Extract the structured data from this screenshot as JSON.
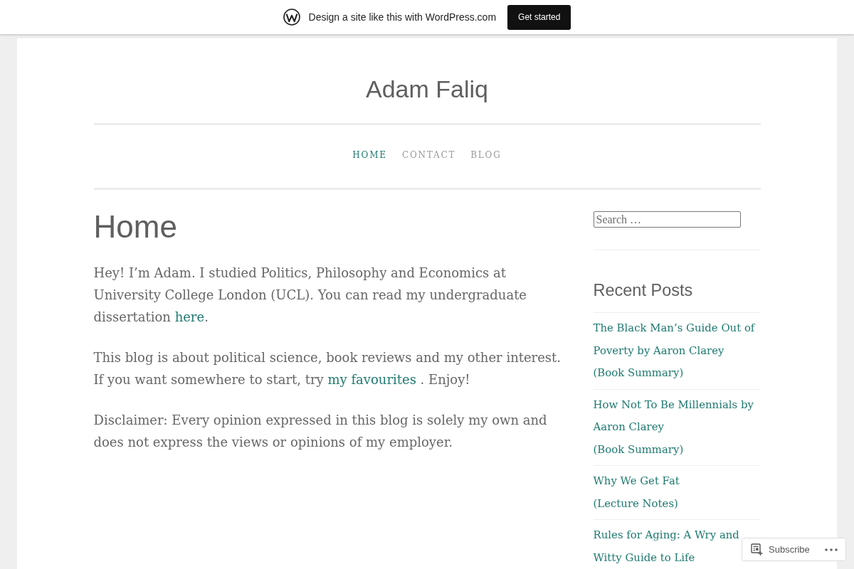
{
  "promo_bar": {
    "text": "Design a site like this with WordPress.com",
    "button": "Get started"
  },
  "site": {
    "title": "Adam Faliq"
  },
  "nav": [
    {
      "label": "HOME",
      "selected": true
    },
    {
      "label": "CONTACT",
      "selected": false
    },
    {
      "label": "BLOG",
      "selected": false
    }
  ],
  "page": {
    "title": "Home",
    "paragraphs": [
      {
        "segments": [
          {
            "kind": "text",
            "text": "Hey! I’m Adam. I studied Politics, Philosophy and Economics at University College London (UCL). You can read my undergraduate dissertation "
          },
          {
            "kind": "link",
            "text": "here"
          },
          {
            "kind": "text",
            "text": "."
          }
        ]
      },
      {
        "segments": [
          {
            "kind": "text",
            "text": "This blog is about political science, book reviews and my other interest. If you want somewhere to start, try "
          },
          {
            "kind": "link",
            "text": "my favourites"
          },
          {
            "kind": "text",
            "text": " . Enjoy!"
          }
        ]
      },
      {
        "segments": [
          {
            "kind": "text",
            "text": "Disclaimer: Every opinion expressed in this blog is solely my own and does not express the views or opinions of my employer."
          }
        ]
      }
    ]
  },
  "sidebar": {
    "search": {
      "placeholder": "Search …"
    },
    "recent_posts": {
      "title": "Recent Posts",
      "items": [
        "The Black Man’s Guide Out of\nPoverty by Aaron Clarey\n(Book Summary)",
        "How Not To Be Millennials by\nAaron Clarey\n(Book Summary)",
        "Why We Get Fat\n(Lecture Notes)",
        "Rules for Aging: A Wry and\nWitty Guide to Life"
      ]
    }
  },
  "subscribe_widget": {
    "label": "Subscribe"
  }
}
